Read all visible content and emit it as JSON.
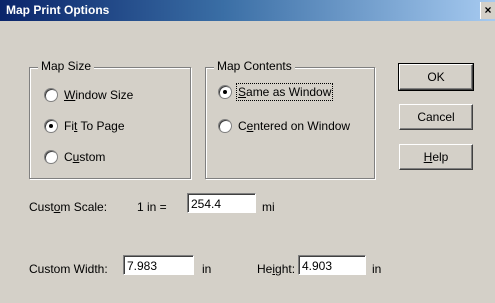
{
  "window": {
    "title": "Map Print Options",
    "close_glyph": "×"
  },
  "map_size": {
    "title": "Map Size",
    "options": [
      {
        "pre": "",
        "u": "W",
        "post": "indow Size",
        "checked": false
      },
      {
        "pre": "Fi",
        "u": "t",
        "post": " To Page",
        "checked": true
      },
      {
        "pre": "C",
        "u": "u",
        "post": "stom",
        "checked": false
      }
    ]
  },
  "map_contents": {
    "title": "Map Contents",
    "options": [
      {
        "pre": "",
        "u": "S",
        "post": "ame as Window",
        "checked": true
      },
      {
        "pre": "C",
        "u": "e",
        "post": "ntered on Window",
        "checked": false
      }
    ]
  },
  "buttons": {
    "ok": "OK",
    "cancel": "Cancel",
    "help_u": "H",
    "help_rest": "elp"
  },
  "custom_scale": {
    "label_pre": "Cust",
    "label_u": "o",
    "label_post": "m Scale:",
    "prefix": "1 in =",
    "value": "254.4",
    "unit": "mi"
  },
  "custom_width": {
    "label": "Custom Width:",
    "value": "7.983",
    "unit": "in"
  },
  "height": {
    "label_pre": "He",
    "label_u": "i",
    "label_post": "ght:",
    "value": "4.903",
    "unit": "in"
  }
}
